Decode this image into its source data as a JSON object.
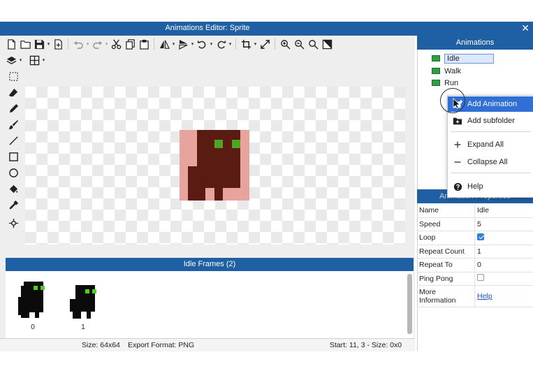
{
  "window": {
    "title": "Animations Editor: Sprite",
    "close_glyph": "✕"
  },
  "toolbar": {
    "row1": [
      "new-file-icon",
      "open-folder-icon",
      "save-icon",
      "export-icon",
      "undo-icon",
      "redo-icon",
      "cut-icon",
      "copy-icon",
      "paste-icon",
      "flip-horizontal-icon",
      "flip-vertical-icon",
      "rotate-left-icon",
      "rotate-right-icon",
      "crop-icon",
      "resize-icon",
      "zoom-in-icon",
      "zoom-out-icon",
      "zoom-fit-icon",
      "fill-canvas-icon"
    ],
    "row2": [
      "layers-icon",
      "grid-icon"
    ]
  },
  "tools": [
    "marquee-select-icon",
    "eraser-icon",
    "pencil-icon",
    "brush-icon",
    "line-icon",
    "rectangle-icon",
    "ellipse-icon",
    "fill-bucket-icon",
    "eyedropper-icon",
    "origin-icon"
  ],
  "frames": {
    "title": "Idle Frames (2)",
    "items": [
      {
        "label": "0"
      },
      {
        "label": "1"
      }
    ]
  },
  "status": {
    "size": "Size: 64x64",
    "format": "Export Format: PNG",
    "selection": "Start: 11, 3 - Size: 0x0"
  },
  "animations_panel": {
    "title": "Animations",
    "items": [
      {
        "label": "Idle",
        "selected": true
      },
      {
        "label": "Walk",
        "selected": false
      },
      {
        "label": "Run",
        "selected": false
      }
    ]
  },
  "context_menu": {
    "items": [
      {
        "label": "Add Animation",
        "icon": "add-animation-icon",
        "highlighted": true
      },
      {
        "label": "Add subfolder",
        "icon": "add-folder-icon",
        "highlighted": false
      },
      {
        "label": "Expand All",
        "icon": "plus-icon",
        "highlighted": false
      },
      {
        "label": "Collapse All",
        "icon": "minus-icon",
        "highlighted": false
      },
      {
        "label": "Help",
        "icon": "help-icon",
        "highlighted": false
      }
    ]
  },
  "properties": {
    "title": "Animation Properties",
    "rows": [
      {
        "key": "Name",
        "value": "Idle"
      },
      {
        "key": "Speed",
        "value": "5"
      },
      {
        "key": "Loop",
        "checked": true
      },
      {
        "key": "Repeat Count",
        "value": "1"
      },
      {
        "key": "Repeat To",
        "value": "0"
      },
      {
        "key": "Ping Pong",
        "checked": false
      },
      {
        "key": "More Information",
        "link": "Help"
      }
    ]
  },
  "colors": {
    "accent": "#1f5fa4",
    "highlight": "#2f6fd6",
    "sprite_body": "#5a1b12",
    "sprite_bg": "#e8a49c",
    "sprite_eye": "#4fa51c"
  }
}
